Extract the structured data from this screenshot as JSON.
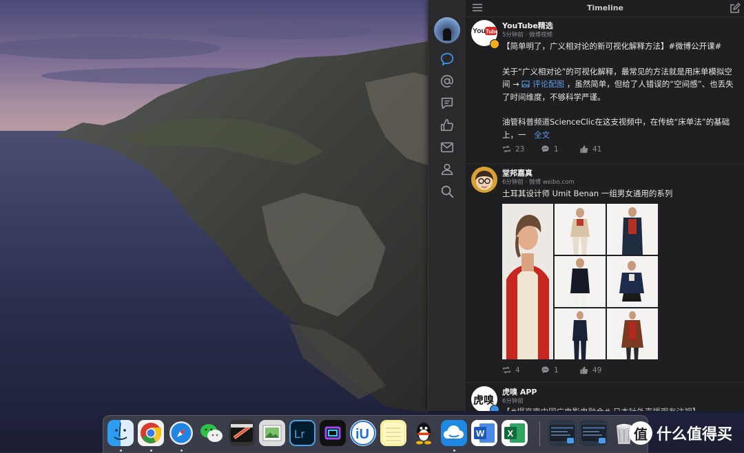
{
  "desktop": {
    "wallpaper": "catalina-island"
  },
  "app": {
    "title": "Timeline",
    "menu_icon": "hamburger-menu-icon",
    "compose_icon": "compose-icon",
    "sidebar": [
      {
        "name": "home",
        "icon": "speech-bubble-icon",
        "active": true
      },
      {
        "name": "mentions",
        "icon": "at-sign-icon"
      },
      {
        "name": "comments",
        "icon": "comment-icon"
      },
      {
        "name": "likes",
        "icon": "thumbs-up-icon"
      },
      {
        "name": "messages",
        "icon": "envelope-icon"
      },
      {
        "name": "profile",
        "icon": "person-icon"
      },
      {
        "name": "search",
        "icon": "search-icon"
      }
    ]
  },
  "posts": [
    {
      "author": "YouTube精选",
      "meta": "5分钟前 · 微博视频",
      "avatar_text": "You Tube",
      "verified_color": "#f2b01e",
      "lines": [
        "【简单明了，广义相对论的新可视化解释方法】#微博公开课#",
        "关于“广义相对论”的可视化解释，最常见的方法就是用床单模拟空",
        "间 →",
        " 评论配图",
        " ，虽然简单，但给了人错误的“空间感”、也丢失",
        "了时间维度，不够科学严谨。",
        "油管科普频道ScienceClic在这支视频中，在传统“床单法”的基础",
        "上，一",
        "全文"
      ],
      "reposts": "23",
      "comments": "1",
      "likes": "41"
    },
    {
      "author": "堂邦嘉真",
      "meta": "6分钟前 · 微博 weibo.com",
      "text": "土耳其设计师 Umit Benan 一组男女通用的系列",
      "photo_count": 7,
      "reposts": "4",
      "comments": "1",
      "likes": "49"
    },
    {
      "author": "虎嗅 APP",
      "meta": "6分钟前",
      "avatar_text": "虎嗅",
      "verified_color": "#3a8ee6",
      "text": "【#提高南中国广电影电融合# 日本针外声援观有注视】"
    }
  ],
  "dock": {
    "apps": [
      {
        "name": "finder",
        "icon": "finder-icon",
        "running": true
      },
      {
        "name": "chrome",
        "icon": "chrome-icon",
        "running": true
      },
      {
        "name": "safari",
        "icon": "safari-icon",
        "running": true
      },
      {
        "name": "wechat",
        "icon": "wechat-icon",
        "running": false
      },
      {
        "name": "final-cut-pro",
        "icon": "final-cut-icon",
        "running": false
      },
      {
        "name": "preview",
        "icon": "preview-icon",
        "running": false
      },
      {
        "name": "lightroom",
        "icon": "lightroom-icon",
        "label": "Lr",
        "running": false
      },
      {
        "name": "screen-app",
        "icon": "screen-app-icon",
        "running": false
      },
      {
        "name": "iu",
        "icon": "iu-icon",
        "label": "iU",
        "running": false
      },
      {
        "name": "notes",
        "icon": "notes-icon",
        "running": false
      },
      {
        "name": "qq",
        "icon": "qq-icon",
        "running": false
      },
      {
        "name": "weibo-client",
        "icon": "weibo-cloud-icon",
        "running": true
      },
      {
        "name": "word",
        "icon": "word-icon",
        "label": "W",
        "running": false
      },
      {
        "name": "excel",
        "icon": "excel-icon",
        "label": "X",
        "running": false
      },
      {
        "name": "window-1",
        "icon": "window-thumbnail-icon",
        "running": false
      },
      {
        "name": "window-2",
        "icon": "window-thumbnail-icon",
        "running": false
      },
      {
        "name": "trash",
        "icon": "trash-icon",
        "running": false
      }
    ]
  },
  "watermark": {
    "text": "什么值得买",
    "logo": "值"
  }
}
